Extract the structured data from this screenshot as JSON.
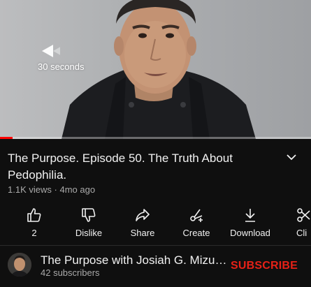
{
  "player": {
    "seek_label": "30 seconds",
    "progress": 0.04
  },
  "video": {
    "title": "The Purpose. Episode 50. The Truth About Pedophilia.",
    "views": "1.1K views",
    "separator": "·",
    "age": "4mo ago"
  },
  "actions": [
    {
      "label": "2",
      "icon": "thumbs-up-icon"
    },
    {
      "label": "Dislike",
      "icon": "thumbs-down-icon"
    },
    {
      "label": "Share",
      "icon": "share-icon"
    },
    {
      "label": "Create",
      "icon": "create-icon"
    },
    {
      "label": "Download",
      "icon": "download-icon"
    },
    {
      "label": "Cli",
      "icon": "scissors-icon"
    }
  ],
  "channel": {
    "name": "The Purpose with Josiah G. Mizuk...",
    "subscribers": "42 subscribers",
    "subscribe_label": "SUBSCRIBE"
  },
  "colors": {
    "background": "#0f0f0f",
    "subscribe": "#e62117",
    "progress": "#ff0000",
    "secondary_text": "#aaaaaa"
  }
}
